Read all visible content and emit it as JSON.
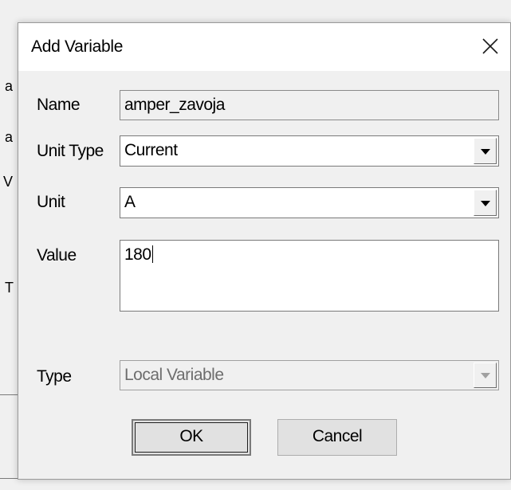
{
  "background": {
    "chars": [
      "a",
      "a",
      "V",
      "T"
    ]
  },
  "dialog": {
    "title": "Add Variable",
    "close_icon": "close-icon",
    "fields": {
      "name": {
        "label": "Name",
        "value": "amper_zavoja"
      },
      "unit_type": {
        "label": "Unit Type",
        "value": "Current"
      },
      "unit": {
        "label": "Unit",
        "value": "A"
      },
      "value": {
        "label": "Value",
        "value": "180"
      },
      "type": {
        "label": "Type",
        "value": "Local Variable"
      }
    },
    "buttons": {
      "ok": "OK",
      "cancel": "Cancel"
    }
  }
}
